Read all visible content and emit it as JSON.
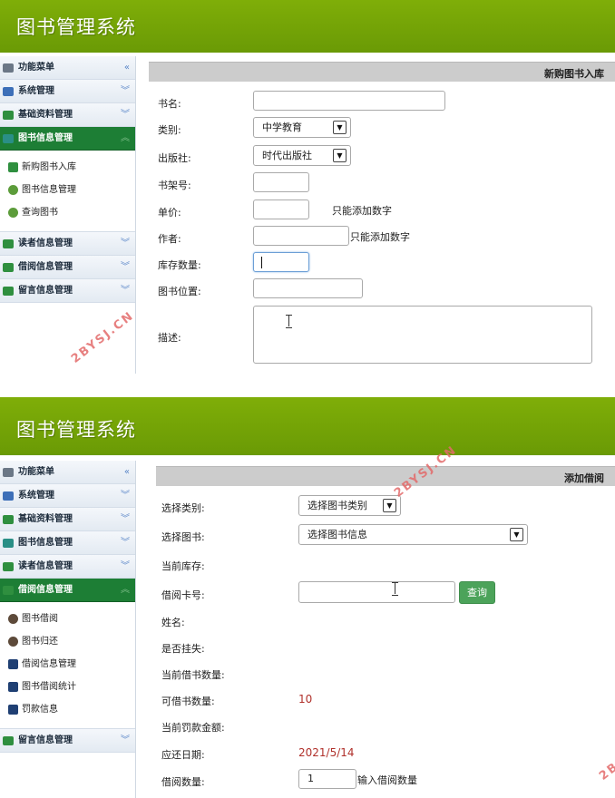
{
  "panel1": {
    "app_title": "图书管理系统",
    "sidebar": {
      "menu_header": "功能菜单",
      "items": [
        {
          "label": "系统管理",
          "icon": "gear-icon"
        },
        {
          "label": "基础资料管理",
          "icon": "card-icon"
        },
        {
          "label": "图书信息管理",
          "icon": "books-icon"
        }
      ],
      "submenu": [
        {
          "label": "新购图书入库",
          "icon": "book-add-icon"
        },
        {
          "label": "图书信息管理",
          "icon": "money-icon"
        },
        {
          "label": "查询图书",
          "icon": "money-icon"
        }
      ],
      "items_after": [
        {
          "label": "读者信息管理",
          "icon": "reader-icon"
        },
        {
          "label": "借阅信息管理",
          "icon": "borrow-icon"
        },
        {
          "label": "留言信息管理",
          "icon": "message-icon"
        }
      ]
    },
    "content": {
      "title": "新购图书入库",
      "fields": {
        "book_name": "书名:",
        "category": "类别:",
        "category_value": "中学教育",
        "publisher": "出版社:",
        "publisher_value": "时代出版社",
        "shelf_no": "书架号:",
        "price": "单价:",
        "price_hint": "只能添加数字",
        "author": "作者:",
        "author_hint": "只能添加数字",
        "stock": "库存数量:",
        "location": "图书位置:",
        "description": "描述:"
      }
    },
    "watermark": "2BYSJ.CN"
  },
  "panel2": {
    "app_title": "图书管理系统",
    "sidebar": {
      "menu_header": "功能菜单",
      "items": [
        {
          "label": "系统管理",
          "icon": "gear-icon"
        },
        {
          "label": "基础资料管理",
          "icon": "card-icon"
        },
        {
          "label": "图书信息管理",
          "icon": "books-icon"
        },
        {
          "label": "读者信息管理",
          "icon": "reader-icon"
        },
        {
          "label": "借阅信息管理",
          "icon": "borrow-icon"
        }
      ],
      "submenu": [
        {
          "label": "图书借阅",
          "icon": "person-icon"
        },
        {
          "label": "图书归还",
          "icon": "person-icon"
        },
        {
          "label": "借阅信息管理",
          "icon": "book-icon"
        },
        {
          "label": "图书借阅统计",
          "icon": "book-icon"
        },
        {
          "label": "罚款信息",
          "icon": "book-icon"
        }
      ],
      "items_after": [
        {
          "label": "留言信息管理",
          "icon": "message-icon"
        }
      ]
    },
    "content": {
      "title": "添加借阅",
      "fields": {
        "select_category": "选择类别:",
        "select_category_value": "选择图书类别",
        "select_book": "选择图书:",
        "select_book_value": "选择图书信息",
        "current_stock": "当前库存:",
        "card_no": "借阅卡号:",
        "query_button": "查询",
        "name": "姓名:",
        "lost": "是否挂失:",
        "current_borrowed": "当前借书数量:",
        "borrowable": "可借书数量:",
        "borrowable_value": "10",
        "current_fine": "当前罚款金额:",
        "due_date": "应还日期:",
        "due_date_value": "2021/5/14",
        "borrow_qty": "借阅数量:",
        "borrow_qty_value": "1",
        "borrow_qty_hint": "输入借阅数量"
      }
    },
    "watermark": "2BYSJ.CN",
    "watermark_partial": "2B"
  },
  "colors": {
    "header_green": "#76a806",
    "active_menu": "#1d7e35",
    "query_button": "#4ca35a",
    "red_value": "#b0302a",
    "watermark": "#e36b6b"
  }
}
